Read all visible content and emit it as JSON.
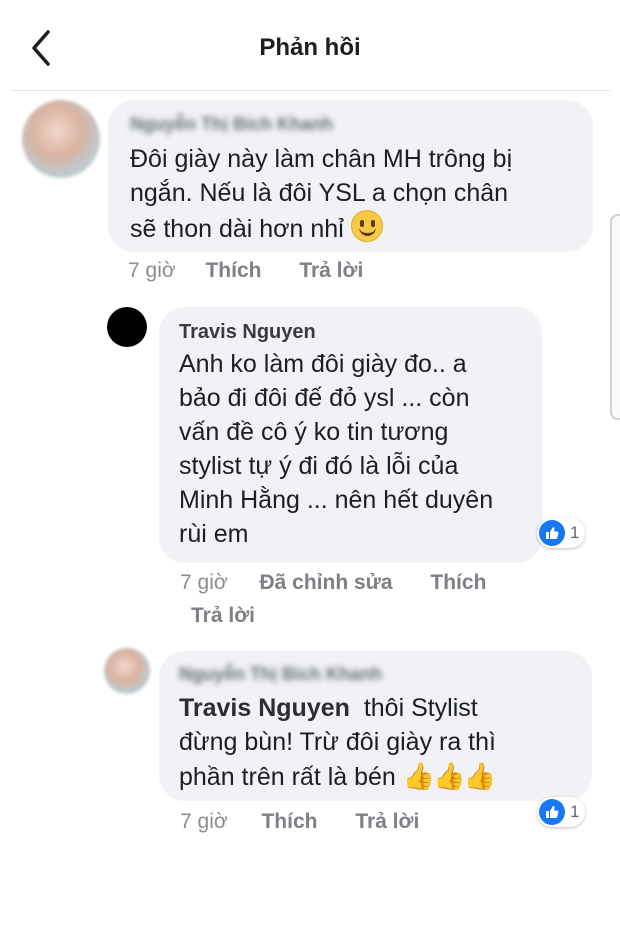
{
  "header": {
    "title": "Phản hồi"
  },
  "comments": [
    {
      "author": "Nguyễn Thị Bích Khanh",
      "lines": [
        "Đôi giày này làm chân MH trông bị",
        "ngắn. Nếu là đôi YSL a chọn chân",
        "sẽ thon dài hơn nhỉ"
      ],
      "emoji": "slightly-smiling-face",
      "time": "7 giờ",
      "like_label": "Thích",
      "reply_label": "Trả lời"
    },
    {
      "author": "Travis Nguyen",
      "lines": [
        "Anh ko làm đôi giày đo.. a",
        "bảo đi đôi đế đỏ ysl ... còn",
        "vấn đề cô ý ko tin tương",
        "stylist tự ý đi đó là lỗi của",
        "Minh Hằng ... nên hết duyên",
        "rùi em"
      ],
      "reaction_count": "1",
      "time": "7 giờ",
      "edited_label": "Đã chỉnh sửa",
      "like_label": "Thích",
      "reply_label": "Trả lời"
    },
    {
      "author": "Nguyễn Thị Bích Khanh",
      "mention": "Travis Nguyen",
      "line1_rest": "thôi Stylist",
      "lines": [
        "đừng bùn! Trừ đôi giày ra thì",
        "phần trên rất là bén"
      ],
      "emoji": "thumbs-up x3",
      "reaction_count": "1",
      "time": "7 giờ",
      "like_label": "Thích",
      "reply_label": "Trả lời"
    }
  ],
  "icons": {
    "back": "back-arrow-icon",
    "like": "like-thumb-icon"
  },
  "colors": {
    "bubble": "#f0f2f5",
    "like_blue": "#1877f2",
    "meta_gray": "#8a8d91"
  }
}
